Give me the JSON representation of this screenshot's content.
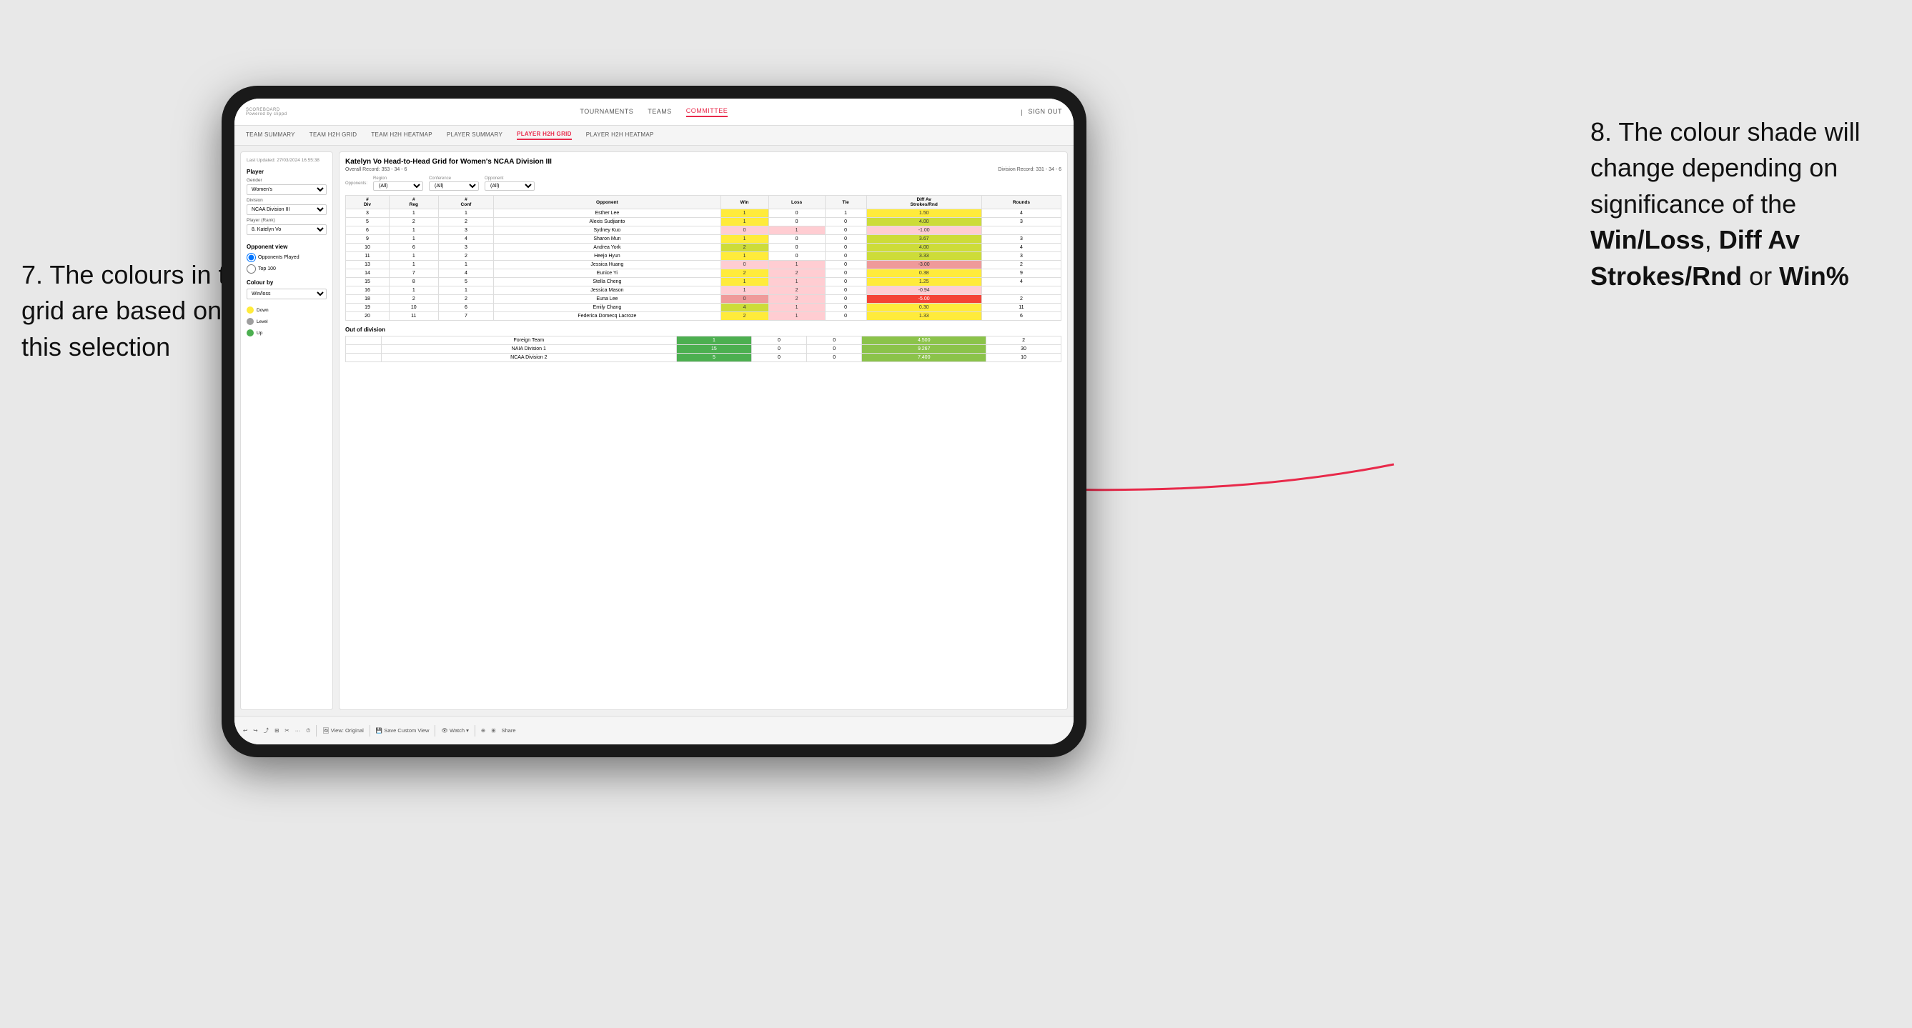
{
  "annotations": {
    "left_number": "7.",
    "left_text": "The colours in the grid are based on this selection",
    "right_number": "8.",
    "right_text1": "The colour shade will change depending on significance of the ",
    "right_bold1": "Win/Loss",
    "right_text2": ", ",
    "right_bold2": "Diff Av Strokes/Rnd",
    "right_text3": " or ",
    "right_bold3": "Win%"
  },
  "nav": {
    "logo": "SCOREBOARD",
    "logo_sub": "Powered by clippd",
    "links": [
      "TOURNAMENTS",
      "TEAMS",
      "COMMITTEE"
    ],
    "active_link": "COMMITTEE",
    "sign_in": "Sign out"
  },
  "sub_nav": {
    "links": [
      "TEAM SUMMARY",
      "TEAM H2H GRID",
      "TEAM H2H HEATMAP",
      "PLAYER SUMMARY",
      "PLAYER H2H GRID",
      "PLAYER H2H HEATMAP"
    ],
    "active_link": "PLAYER H2H GRID"
  },
  "sidebar": {
    "timestamp": "Last Updated: 27/03/2024 16:55:38",
    "player_section": "Player",
    "gender_label": "Gender",
    "gender_value": "Women's",
    "division_label": "Division",
    "division_value": "NCAA Division III",
    "player_rank_label": "Player (Rank)",
    "player_rank_value": "8. Katelyn Vo",
    "opponent_view_title": "Opponent view",
    "radio1": "Opponents Played",
    "radio2": "Top 100",
    "colour_by_title": "Colour by",
    "colour_by_value": "Win/loss",
    "legend_down": "Down",
    "legend_level": "Level",
    "legend_up": "Up"
  },
  "grid": {
    "title": "Katelyn Vo Head-to-Head Grid for Women's NCAA Division III",
    "overall_record_label": "Overall Record:",
    "overall_record_value": "353 - 34 - 6",
    "division_record_label": "Division Record:",
    "division_record_value": "331 - 34 - 6",
    "opponents_label": "Opponents:",
    "region_label": "Region",
    "conference_label": "Conference",
    "opponent_label": "Opponent",
    "filter_all": "(All)",
    "columns": [
      "#\nDiv",
      "#\nReg",
      "#\nConf",
      "Opponent",
      "Win",
      "Loss",
      "Tie",
      "Diff Av\nStrokes/Rnd",
      "Rounds"
    ],
    "rows": [
      {
        "div": "3",
        "reg": "1",
        "conf": "1",
        "opponent": "Esther Lee",
        "win": 1,
        "loss": 0,
        "tie": 1,
        "diff": "1.50",
        "rounds": "4",
        "win_color": "cell-yellow",
        "diff_color": "cell-yellow"
      },
      {
        "div": "5",
        "reg": "2",
        "conf": "2",
        "opponent": "Alexis Sudjianto",
        "win": 1,
        "loss": 0,
        "tie": 0,
        "diff": "4.00",
        "rounds": "3",
        "win_color": "cell-yellow",
        "diff_color": "cell-green-light"
      },
      {
        "div": "6",
        "reg": "1",
        "conf": "3",
        "opponent": "Sydney Kuo",
        "win": 0,
        "loss": 1,
        "tie": 0,
        "diff": "-1.00",
        "rounds": "",
        "win_color": "cell-red-light",
        "diff_color": "cell-red-light"
      },
      {
        "div": "9",
        "reg": "1",
        "conf": "4",
        "opponent": "Sharon Mun",
        "win": 1,
        "loss": 0,
        "tie": 0,
        "diff": "3.67",
        "rounds": "3",
        "win_color": "cell-yellow",
        "diff_color": "cell-green-light"
      },
      {
        "div": "10",
        "reg": "6",
        "conf": "3",
        "opponent": "Andrea York",
        "win": 2,
        "loss": 0,
        "tie": 0,
        "diff": "4.00",
        "rounds": "4",
        "win_color": "cell-green-light",
        "diff_color": "cell-green-light"
      },
      {
        "div": "11",
        "reg": "1",
        "conf": "2",
        "opponent": "Heejo Hyun",
        "win": 1,
        "loss": 0,
        "tie": 0,
        "diff": "3.33",
        "rounds": "3",
        "win_color": "cell-yellow",
        "diff_color": "cell-green-light"
      },
      {
        "div": "13",
        "reg": "1",
        "conf": "1",
        "opponent": "Jessica Huang",
        "win": 0,
        "loss": 1,
        "tie": 0,
        "diff": "-3.00",
        "rounds": "2",
        "win_color": "cell-red-light",
        "diff_color": "cell-red-med"
      },
      {
        "div": "14",
        "reg": "7",
        "conf": "4",
        "opponent": "Eunice Yi",
        "win": 2,
        "loss": 2,
        "tie": 0,
        "diff": "0.38",
        "rounds": "9",
        "win_color": "cell-yellow",
        "diff_color": "cell-yellow"
      },
      {
        "div": "15",
        "reg": "8",
        "conf": "5",
        "opponent": "Stella Cheng",
        "win": 1,
        "loss": 1,
        "tie": 0,
        "diff": "1.25",
        "rounds": "4",
        "win_color": "cell-yellow",
        "diff_color": "cell-yellow"
      },
      {
        "div": "16",
        "reg": "1",
        "conf": "1",
        "opponent": "Jessica Mason",
        "win": 1,
        "loss": 2,
        "tie": 0,
        "diff": "-0.94",
        "rounds": "",
        "win_color": "cell-red-light",
        "diff_color": "cell-red-light"
      },
      {
        "div": "18",
        "reg": "2",
        "conf": "2",
        "opponent": "Euna Lee",
        "win": 0,
        "loss": 2,
        "tie": 0,
        "diff": "-5.00",
        "rounds": "2",
        "win_color": "cell-red-med",
        "diff_color": "cell-red-dark"
      },
      {
        "div": "19",
        "reg": "10",
        "conf": "6",
        "opponent": "Emily Chang",
        "win": 4,
        "loss": 1,
        "tie": 0,
        "diff": "0.30",
        "rounds": "11",
        "win_color": "cell-green-light",
        "diff_color": "cell-yellow"
      },
      {
        "div": "20",
        "reg": "11",
        "conf": "7",
        "opponent": "Federica Domecq Lacroze",
        "win": 2,
        "loss": 1,
        "tie": 0,
        "diff": "1.33",
        "rounds": "6",
        "win_color": "cell-yellow",
        "diff_color": "cell-yellow"
      }
    ],
    "out_of_division_title": "Out of division",
    "ood_rows": [
      {
        "label": "Foreign Team",
        "win": 1,
        "loss": 0,
        "tie": 0,
        "diff": "4.500",
        "rounds": "2"
      },
      {
        "label": "NAIA Division 1",
        "win": 15,
        "loss": 0,
        "tie": 0,
        "diff": "9.267",
        "rounds": "30"
      },
      {
        "label": "NCAA Division 2",
        "win": 5,
        "loss": 0,
        "tie": 0,
        "diff": "7.400",
        "rounds": "10"
      }
    ]
  },
  "toolbar": {
    "buttons": [
      "↩",
      "↪",
      "⤴",
      "⊞",
      "✂",
      "·",
      "⏱",
      "|",
      "View: Original",
      "|",
      "Save Custom View",
      "|",
      "👁 Watch ▾",
      "|",
      "⊕",
      "⊞",
      "Share"
    ]
  }
}
